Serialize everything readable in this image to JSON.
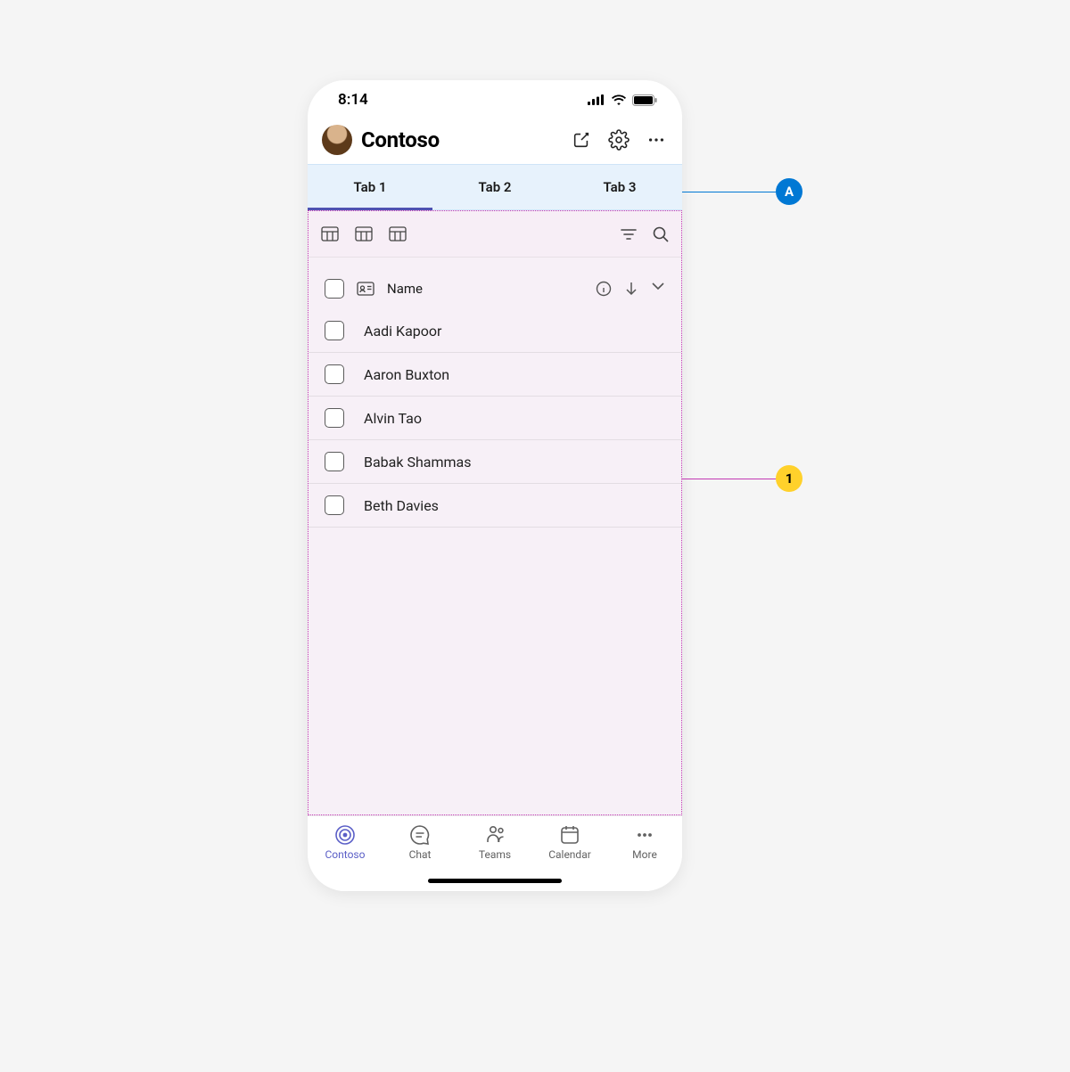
{
  "status": {
    "time": "8:14"
  },
  "header": {
    "title": "Contoso"
  },
  "tabs": [
    {
      "label": "Tab 1",
      "active": true
    },
    {
      "label": "Tab 2",
      "active": false
    },
    {
      "label": "Tab 3",
      "active": false
    }
  ],
  "list": {
    "header_label": "Name",
    "rows": [
      {
        "name": "Aadi Kapoor"
      },
      {
        "name": "Aaron Buxton"
      },
      {
        "name": "Alvin Tao"
      },
      {
        "name": "Babak Shammas"
      },
      {
        "name": "Beth Davies"
      }
    ]
  },
  "nav": [
    {
      "label": "Contoso",
      "active": true
    },
    {
      "label": "Chat",
      "active": false
    },
    {
      "label": "Teams",
      "active": false
    },
    {
      "label": "Calendar",
      "active": false
    },
    {
      "label": "More",
      "active": false
    }
  ],
  "annotations": {
    "a": "A",
    "one": "1"
  }
}
